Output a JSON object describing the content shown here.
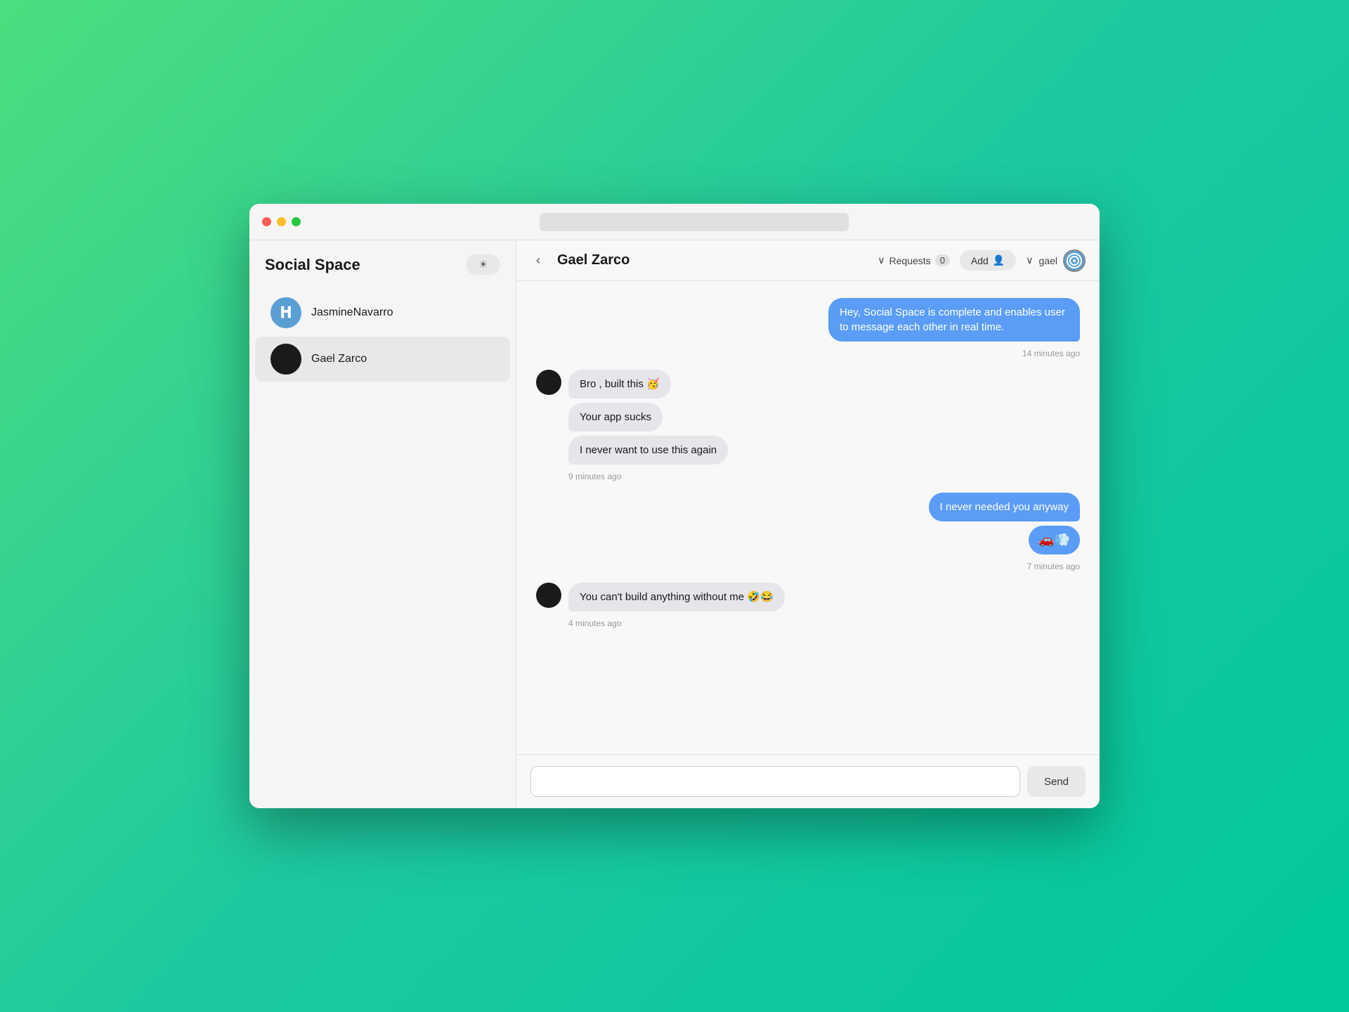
{
  "app": {
    "title": "Social Space",
    "theme_toggle_label": "☀",
    "back_icon": "‹"
  },
  "sidebar": {
    "title": "Social Space",
    "contacts": [
      {
        "id": "jasmine",
        "name": "JasmineNavarro",
        "avatar_type": "icon",
        "active": false
      },
      {
        "id": "gael",
        "name": "Gael Zarco",
        "avatar_type": "circle",
        "active": true
      }
    ]
  },
  "chat": {
    "title": "Gael Zarco",
    "requests_label": "Requests",
    "requests_count": "0",
    "add_label": "Add",
    "username": "gael",
    "messages": [
      {
        "id": "m1",
        "side": "right",
        "text": "Hey, Social Space is complete and enables user to message each other in real time.",
        "timestamp": "14 minutes ago",
        "type": "text"
      },
      {
        "id": "m2",
        "side": "left",
        "text": "Bro , built this 🥳",
        "type": "text"
      },
      {
        "id": "m3",
        "side": "left",
        "text": "Your app sucks",
        "type": "text"
      },
      {
        "id": "m4",
        "side": "left",
        "text": "I never want to use this again",
        "timestamp": "9 minutes ago",
        "type": "text"
      },
      {
        "id": "m5",
        "side": "right",
        "text": "I never needed you anyway",
        "type": "text"
      },
      {
        "id": "m6",
        "side": "right",
        "text": "🚗💨",
        "timestamp": "7 minutes ago",
        "type": "reaction"
      },
      {
        "id": "m7",
        "side": "left",
        "text": "You can't build anything without me 🤣😂",
        "timestamp": "4 minutes ago",
        "type": "text"
      }
    ]
  },
  "input": {
    "placeholder": "",
    "send_label": "Send"
  }
}
